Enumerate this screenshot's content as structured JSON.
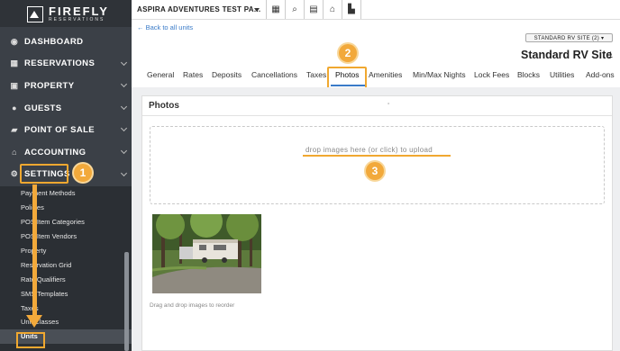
{
  "brand": {
    "name": "FIREFLY",
    "sub": "RESERVATIONS"
  },
  "topbar": {
    "site_name": "ASPIRA ADVENTURES TEST PA...",
    "icons": [
      "grid-icon",
      "search-icon",
      "calendar-icon",
      "home-icon",
      "building-icon"
    ]
  },
  "sidebar": {
    "items": [
      {
        "label": "DASHBOARD",
        "icon": "dashboard-icon"
      },
      {
        "label": "RESERVATIONS",
        "icon": "calendar-icon"
      },
      {
        "label": "PROPERTY",
        "icon": "property-icon"
      },
      {
        "label": "GUESTS",
        "icon": "user-icon"
      },
      {
        "label": "POINT OF SALE",
        "icon": "cart-icon"
      },
      {
        "label": "ACCOUNTING",
        "icon": "bank-icon"
      },
      {
        "label": "SETTINGS",
        "icon": "gear-icon"
      }
    ],
    "submenu": [
      "Payment Methods",
      "Policies",
      "POS Item Categories",
      "POS Item Vendors",
      "Property",
      "Reservation Grid",
      "Rate Qualifiers",
      "SMS Templates",
      "Taxes",
      "Unit Classes",
      "Units"
    ]
  },
  "page": {
    "back_link": "← Back to all units",
    "badge": "STANDARD RV SITE (2) ▾",
    "title": "Standard RV Site",
    "title_num": "1"
  },
  "tabs": [
    "General",
    "Rates",
    "Deposits",
    "Cancellations",
    "Taxes",
    "Photos",
    "Amenities",
    "Min/Max Nights",
    "Lock Fees",
    "Blocks",
    "Utilities",
    "Add-ons"
  ],
  "active_tab": "Photos",
  "panel": {
    "title": "Photos",
    "dot": "-",
    "drop_text": "drop images here (or click) to upload",
    "reorder_hint": "Drag and drop images to reorder"
  },
  "callouts": [
    "1",
    "2",
    "3"
  ],
  "colors": {
    "accent": "#f2a93b",
    "link": "#3a7bc8",
    "sidebar": "#3b4047"
  }
}
